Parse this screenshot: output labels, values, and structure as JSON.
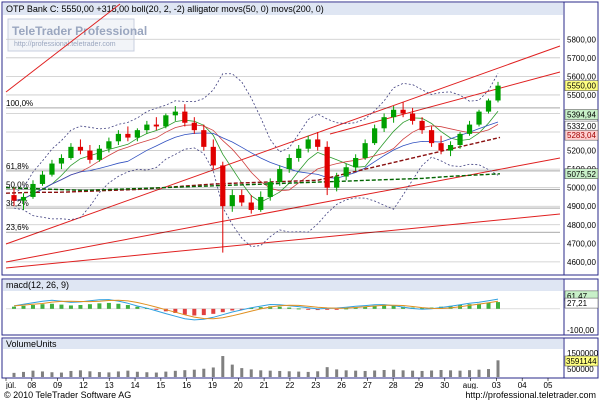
{
  "header": {
    "title": "OTP Bank C: 5550,00 +315,00 boll(20, 2, -2) alligator movs(50, 0) movs(200, 0)"
  },
  "watermark": {
    "brand": "TeleTrader Professional",
    "url": "http://professional.teletrader.com"
  },
  "footer": {
    "copyright": "© 2010 TeleTrader Software AG",
    "url": "http://professional.teletrader.com"
  },
  "colors": {
    "frame": "#2a2a8a",
    "panel_header": "#dfe6f3",
    "up_candle": "#00a000",
    "down_candle": "#e00000",
    "trendline": "#e02020",
    "boll": "#404080",
    "ma50": "#8a1010",
    "ma200": "#006400",
    "highlight_price": "#ffff80"
  },
  "chart_data": [
    {
      "type": "candlestick",
      "name": "price",
      "ylim": [
        4540,
        5920
      ],
      "y_ticks": [
        "4600,00",
        "4700,00",
        "4800,00",
        "4900,00",
        "5000,00",
        "5100,00",
        "5200,00",
        "5300,00",
        "5400,00",
        "5500,00",
        "5600,00",
        "5700,00",
        "5800,00"
      ],
      "x_ticks": [
        "júl.",
        "08",
        "09",
        "12",
        "13",
        "14",
        "15",
        "16",
        "19",
        "20",
        "21",
        "22",
        "23",
        "26",
        "27",
        "28",
        "29",
        "30",
        "aug.",
        "03",
        "04",
        "05"
      ],
      "price_labels": [
        {
          "text": "5550,00",
          "value": 5550,
          "style": "highlight"
        },
        {
          "text": "5394,94",
          "value": 5394,
          "style": "green"
        },
        {
          "text": "5332,00",
          "value": 5332,
          "style": "plain"
        },
        {
          "text": "5283,04",
          "value": 5283,
          "style": "red"
        },
        {
          "text": "5075,52",
          "value": 5075,
          "style": "green"
        }
      ],
      "fib_levels": [
        {
          "label": "100,0%",
          "value": 5430
        },
        {
          "label": "61,8%",
          "value": 5090
        },
        {
          "label": "50,0%",
          "value": 4990
        },
        {
          "label": "38,2%",
          "value": 4890
        },
        {
          "label": "23,6%",
          "value": 4760
        }
      ],
      "ohlc": [
        [
          4960,
          5000,
          4900,
          4930
        ],
        [
          4930,
          4970,
          4880,
          4950
        ],
        [
          4950,
          5040,
          4940,
          5020
        ],
        [
          5020,
          5090,
          5010,
          5070
        ],
        [
          5070,
          5150,
          5060,
          5130
        ],
        [
          5130,
          5180,
          5100,
          5160
        ],
        [
          5160,
          5240,
          5150,
          5220
        ],
        [
          5220,
          5260,
          5180,
          5200
        ],
        [
          5200,
          5230,
          5130,
          5150
        ],
        [
          5150,
          5230,
          5140,
          5210
        ],
        [
          5210,
          5270,
          5190,
          5250
        ],
        [
          5250,
          5310,
          5230,
          5290
        ],
        [
          5290,
          5330,
          5250,
          5270
        ],
        [
          5270,
          5320,
          5250,
          5310
        ],
        [
          5310,
          5360,
          5290,
          5340
        ],
        [
          5340,
          5380,
          5310,
          5330
        ],
        [
          5330,
          5400,
          5320,
          5390
        ],
        [
          5390,
          5440,
          5360,
          5410
        ],
        [
          5410,
          5450,
          5330,
          5350
        ],
        [
          5350,
          5380,
          5290,
          5310
        ],
        [
          5310,
          5340,
          5200,
          5220
        ],
        [
          5220,
          5260,
          5100,
          5120
        ],
        [
          5120,
          5140,
          4650,
          4900
        ],
        [
          4900,
          4990,
          4870,
          4960
        ],
        [
          4960,
          4990,
          4900,
          4920
        ],
        [
          4920,
          4960,
          4860,
          4880
        ],
        [
          4880,
          4980,
          4870,
          4950
        ],
        [
          4950,
          5050,
          4930,
          5030
        ],
        [
          5030,
          5120,
          5010,
          5100
        ],
        [
          5100,
          5180,
          5080,
          5160
        ],
        [
          5160,
          5230,
          5140,
          5210
        ],
        [
          5210,
          5280,
          5190,
          5260
        ],
        [
          5260,
          5300,
          5200,
          5220
        ],
        [
          5220,
          5250,
          4960,
          5000
        ],
        [
          5000,
          5080,
          4980,
          5060
        ],
        [
          5060,
          5130,
          5040,
          5110
        ],
        [
          5110,
          5180,
          5090,
          5160
        ],
        [
          5160,
          5260,
          5150,
          5240
        ],
        [
          5240,
          5340,
          5230,
          5320
        ],
        [
          5320,
          5400,
          5300,
          5380
        ],
        [
          5380,
          5440,
          5350,
          5420
        ],
        [
          5420,
          5460,
          5380,
          5400
        ],
        [
          5400,
          5430,
          5340,
          5360
        ],
        [
          5360,
          5380,
          5290,
          5310
        ],
        [
          5310,
          5330,
          5220,
          5240
        ],
        [
          5240,
          5280,
          5180,
          5200
        ],
        [
          5200,
          5250,
          5170,
          5230
        ],
        [
          5230,
          5300,
          5210,
          5290
        ],
        [
          5290,
          5360,
          5280,
          5340
        ],
        [
          5340,
          5420,
          5330,
          5410
        ],
        [
          5410,
          5480,
          5400,
          5470
        ],
        [
          5470,
          5570,
          5460,
          5550
        ]
      ],
      "ma50": [
        4970,
        4975,
        4975,
        4980,
        4985,
        4990,
        5000,
        5010,
        5020,
        5025,
        5030,
        5035,
        5040,
        5045,
        5050,
        5055,
        5060,
        5065,
        5070,
        5075
      ],
      "ma200": [
        5000,
        4995,
        4990,
        4985,
        4990,
        4995,
        5000,
        5005,
        5010,
        5015,
        5020,
        5025,
        5030,
        5035,
        5040,
        5045,
        5050,
        5060,
        5068,
        5075
      ]
    },
    {
      "type": "bar",
      "name": "macd(12, 26, 9)",
      "ylim": [
        -120,
        80
      ],
      "y_ticks": [
        "-100,00"
      ],
      "value_labels": [
        {
          "text": "61,47",
          "value": 61.47,
          "style": "green"
        },
        {
          "text": "27,21",
          "value": 27.21,
          "style": "plain"
        }
      ],
      "histogram": [
        10,
        14,
        18,
        22,
        24,
        20,
        16,
        18,
        22,
        26,
        28,
        24,
        18,
        10,
        4,
        -4,
        -12,
        -20,
        -28,
        -32,
        -30,
        -24,
        -16,
        -8,
        -2,
        4,
        8,
        12,
        10,
        6,
        2,
        -2,
        -6,
        -4,
        -2,
        2,
        6,
        10,
        14,
        16,
        14,
        10,
        6,
        4,
        6,
        10,
        14,
        18,
        22,
        24,
        28,
        32
      ]
    },
    {
      "type": "bar",
      "name": "VolumeUnits",
      "ylim": [
        0,
        1700000
      ],
      "y_ticks": [
        "1500000",
        "1000000",
        "500000"
      ],
      "value_labels": [
        {
          "text": "3591144",
          "value": 3591144,
          "style": "highlight"
        }
      ],
      "values": [
        260000,
        320000,
        400000,
        350000,
        300000,
        280000,
        380000,
        420000,
        360000,
        310000,
        290000,
        350000,
        400000,
        330000,
        300000,
        280000,
        340000,
        390000,
        430000,
        460000,
        520000,
        600000,
        1320000,
        780000,
        560000,
        480000,
        420000,
        400000,
        380000,
        360000,
        340000,
        320000,
        360000,
        620000,
        480000,
        420000,
        400000,
        380000,
        410000,
        440000,
        460000,
        420000,
        400000,
        380000,
        410000,
        440000,
        420000,
        400000,
        430000,
        460000,
        500000,
        1050000
      ]
    }
  ]
}
